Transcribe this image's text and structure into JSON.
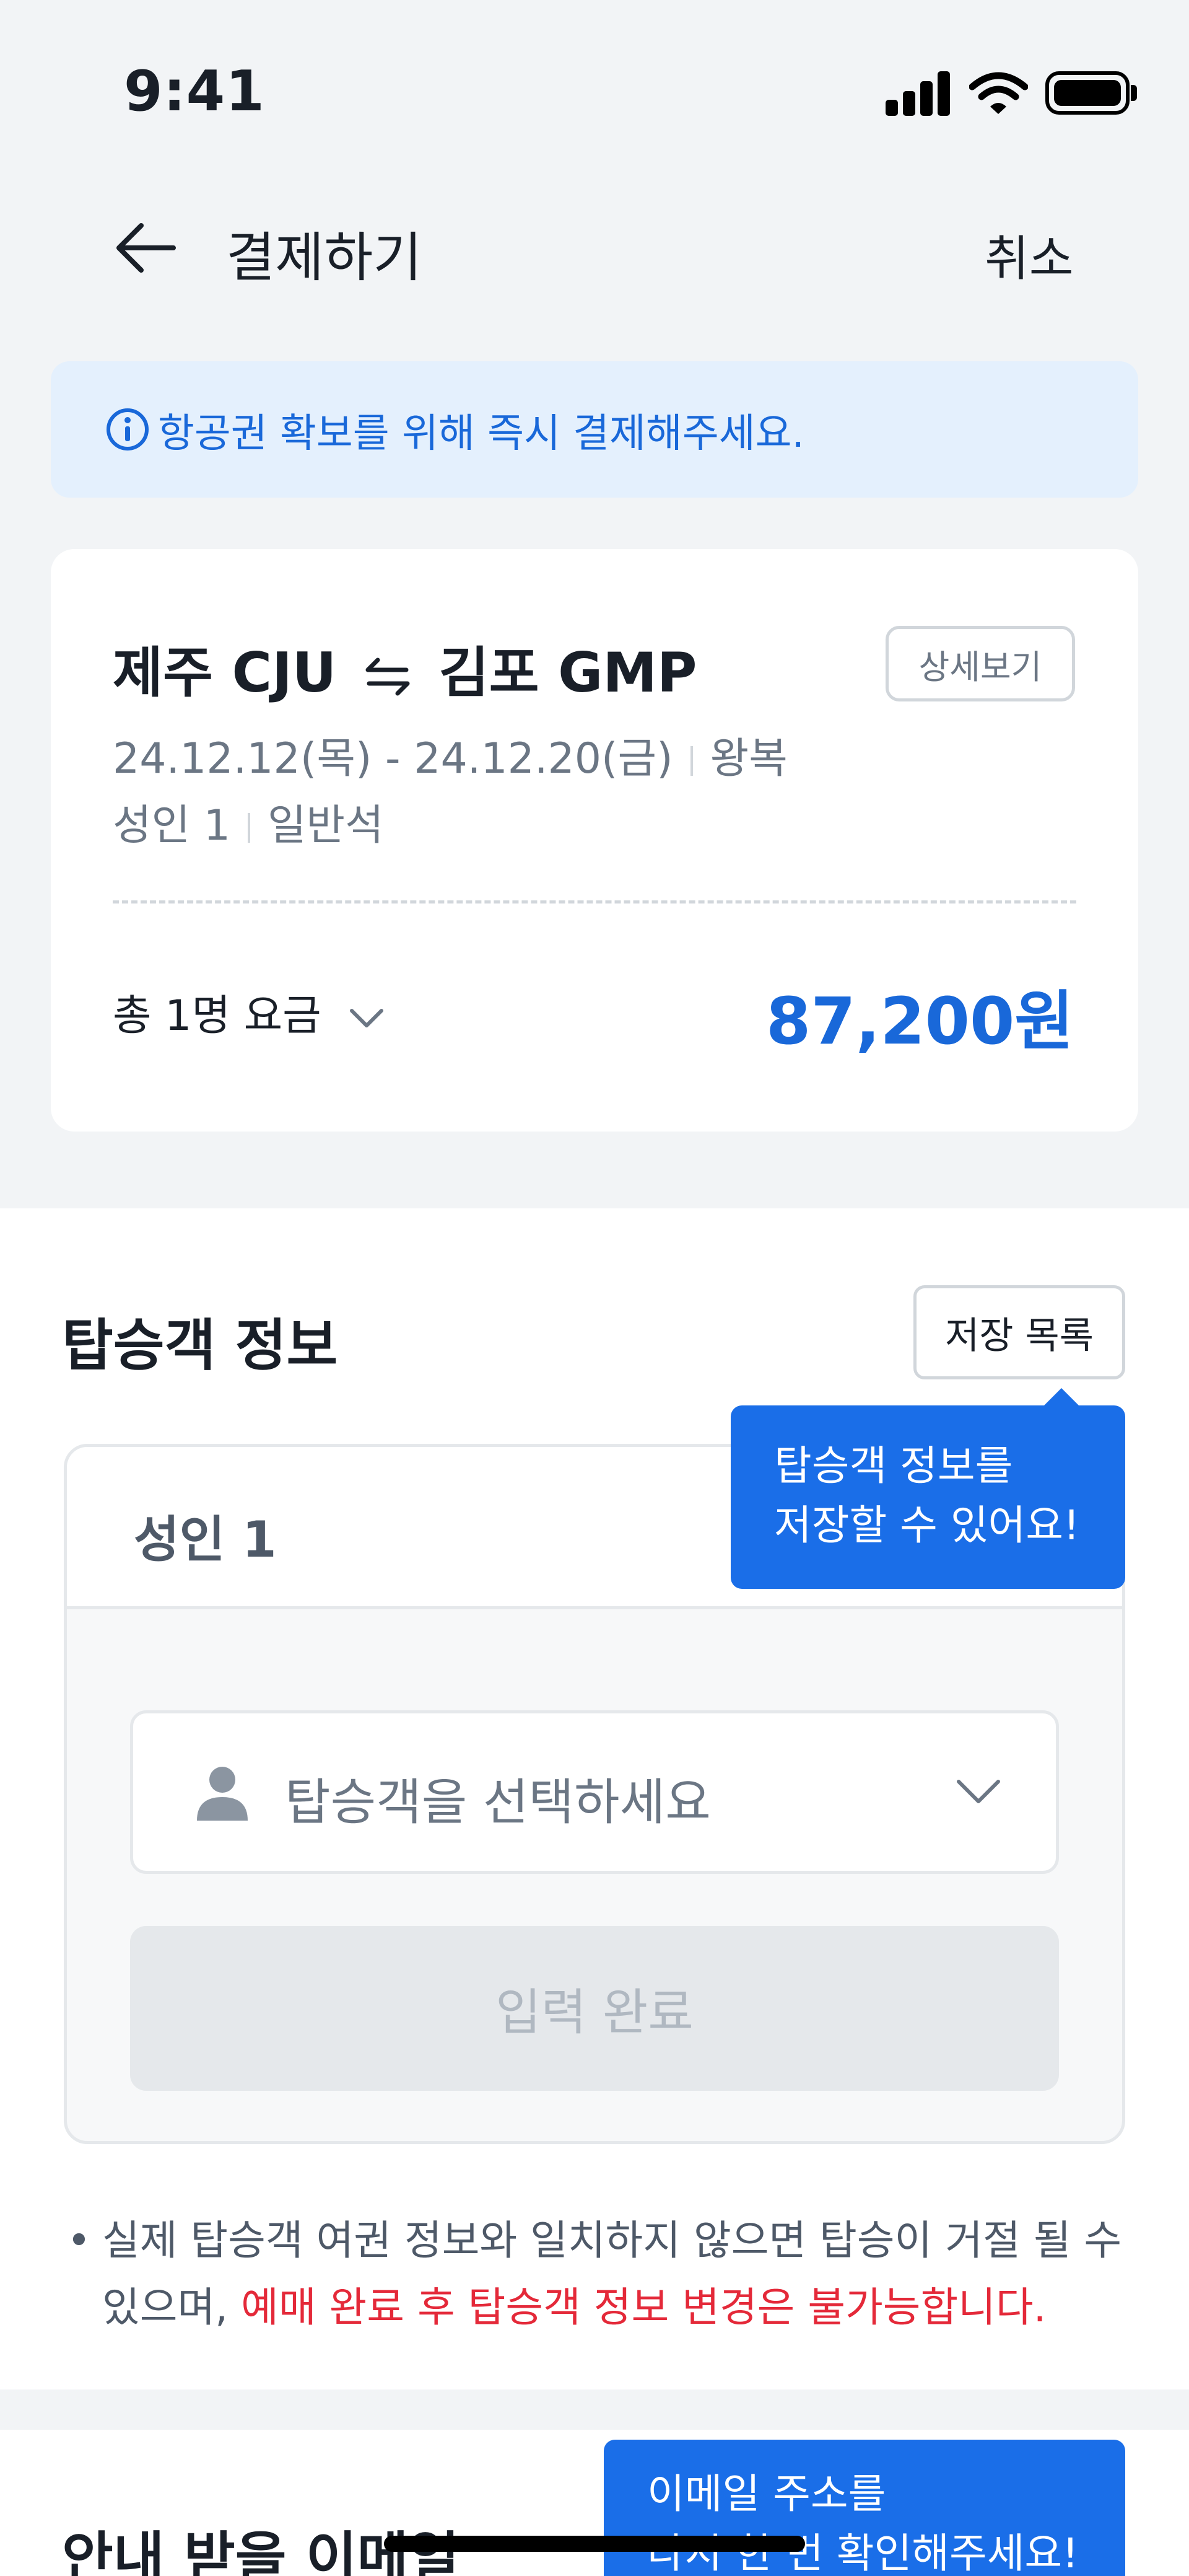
{
  "status_bar": {
    "time": "9:41"
  },
  "header": {
    "title": "결제하기",
    "cancel_label": "취소"
  },
  "banner": {
    "text": "항공권 확보를 위해 즉시 결제해주세요."
  },
  "flight": {
    "from": "제주 CJU",
    "to": "김포 GMP",
    "detail_label": "상세보기",
    "dates": "24.12.12(목) - 24.12.20(금)",
    "trip_type": "왕복",
    "passengers": "성인 1",
    "seat_class": "일반석",
    "fare_label": "총 1명 요금",
    "fare_price": "87,200원"
  },
  "passenger_section": {
    "title": "탑승객 정보",
    "saved_list_label": "저장 목록",
    "tooltip_line1": "탑승객 정보를",
    "tooltip_line2": "저장할 수 있어요!",
    "passenger_label": "성인 1",
    "select_placeholder": "탑승객을 선택하세요",
    "submit_label": "입력 완료",
    "notice_bullet": "•",
    "notice_text": "실제 탑승객 여권 정보와 일치하지 않으면 탑승이 거절 될 수 있으며, ",
    "notice_warning": "예매 완료 후 탑승객 정보 변경은 불가능합니다."
  },
  "email_section": {
    "title": "안내 받을 이메일",
    "tooltip_line1": "이메일 주소를",
    "tooltip_line2": "다시 한 번 확인해주세요!"
  },
  "colors": {
    "accent": "#1968D9",
    "tooltip": "#1A6EE8",
    "warning": "#E42939",
    "banner_bg": "#E4F0FD"
  },
  "icons": [
    "signal-icon",
    "wifi-icon",
    "battery-icon",
    "back-arrow-icon",
    "info-icon",
    "swap-icon",
    "chevron-down-icon",
    "person-icon"
  ]
}
